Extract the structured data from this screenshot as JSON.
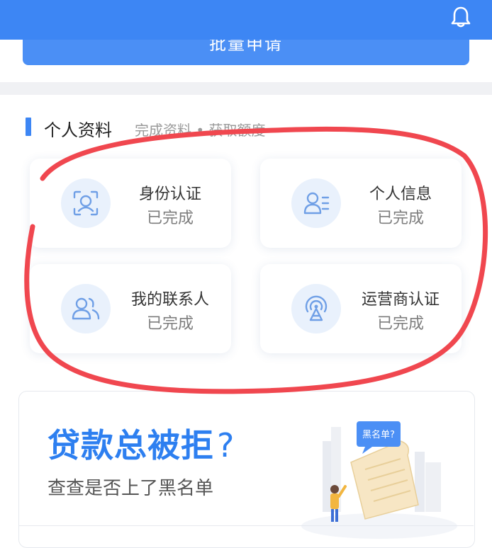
{
  "header": {
    "bell_icon": "bell-icon",
    "apply_button_label": "批量申请"
  },
  "profile": {
    "title": "个人资料",
    "subtitle": "完成资料 • 获取额度",
    "cards": [
      {
        "label": "身份认证",
        "status": "已完成",
        "icon": "id-verify-icon"
      },
      {
        "label": "个人信息",
        "status": "已完成",
        "icon": "personal-info-icon"
      },
      {
        "label": "我的联系人",
        "status": "已完成",
        "icon": "contacts-icon"
      },
      {
        "label": "运营商认证",
        "status": "已完成",
        "icon": "carrier-signal-icon"
      }
    ]
  },
  "banner": {
    "title": "贷款总被拒",
    "title_mark": "?",
    "subtitle": "查查是否上了黑名单",
    "bubble_text": "黑名单?"
  },
  "colors": {
    "primary": "#3d86f4",
    "annotation_red": "#f0474f",
    "icon_bg": "#e9f1fc"
  }
}
